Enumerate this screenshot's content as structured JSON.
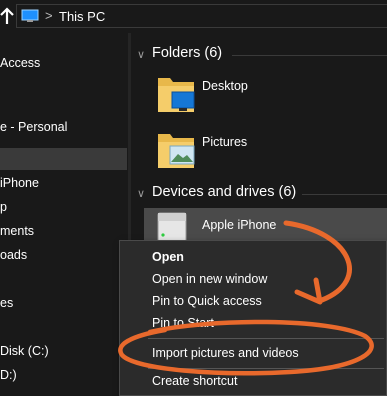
{
  "address_bar": {
    "back_icon": "up-arrow-icon",
    "location_icon": "this-pc-icon",
    "separator": ">",
    "path": "This PC"
  },
  "nav": {
    "items": [
      {
        "label": "Access",
        "selected": false
      },
      {
        "label": "e - Personal",
        "selected": false
      },
      {
        "label": "",
        "selected": true
      },
      {
        "label": "iPhone",
        "selected": false
      },
      {
        "label": "p",
        "selected": false
      },
      {
        "label": "ments",
        "selected": false
      },
      {
        "label": "oads",
        "selected": false
      },
      {
        "label": "es",
        "selected": false
      },
      {
        "label": "Disk (C:)",
        "selected": false
      },
      {
        "label": "D:)",
        "selected": false
      }
    ]
  },
  "main": {
    "folders_header": "Folders (6)",
    "folders": [
      {
        "label": "Desktop",
        "icon": "desktop-folder-icon"
      },
      {
        "label": "Pictures",
        "icon": "pictures-folder-icon"
      }
    ],
    "devices_header": "Devices and drives (6)",
    "device": {
      "label": "Apple iPhone",
      "icon": "iphone-device-icon"
    }
  },
  "context_menu": {
    "items": [
      {
        "label": "Open",
        "bold": true
      },
      {
        "label": "Open in new window",
        "bold": false
      },
      {
        "label": "Pin to Quick access",
        "bold": false
      },
      {
        "label": "Pin to Start",
        "bold": false
      },
      {
        "label": "Import pictures and videos",
        "bold": false,
        "highlighted": true
      },
      {
        "label": "Create shortcut",
        "bold": false
      }
    ]
  },
  "colors": {
    "background": "#191919",
    "menu_background": "#2b2b2b",
    "selected_tile": "#4a4a4a",
    "annotation": "#e8692c"
  }
}
